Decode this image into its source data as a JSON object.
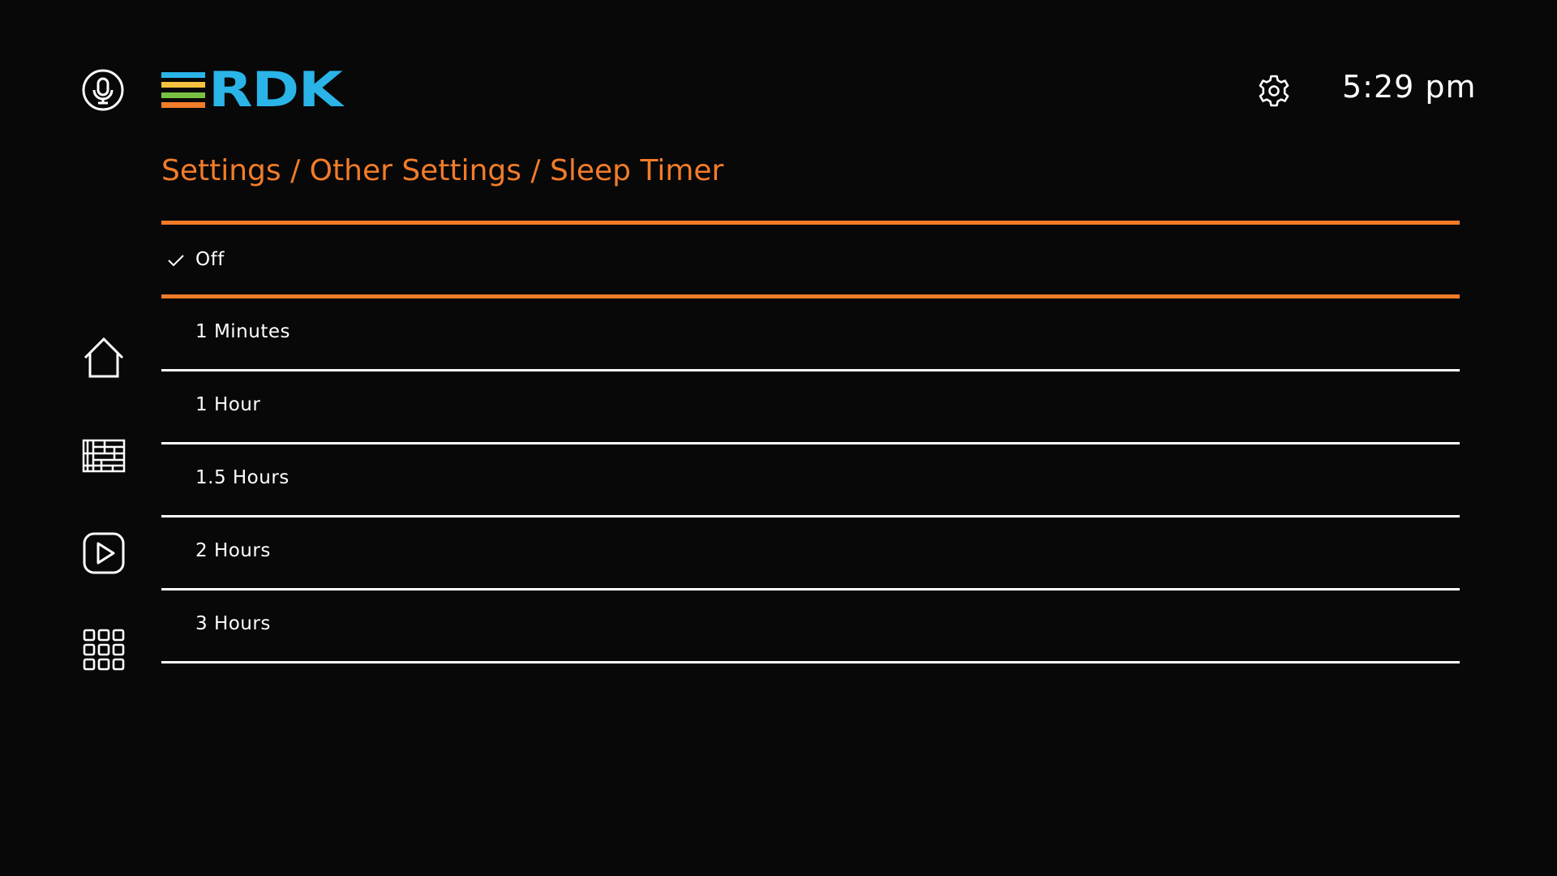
{
  "header": {
    "logo_text": "RDK",
    "logo_colors": [
      "#2ab4e8",
      "#f6c23e",
      "#7ac143",
      "#f27c2a"
    ],
    "time": "5:29 pm",
    "icons": {
      "mic": "microphone-icon",
      "settings": "gear-icon"
    }
  },
  "sidebar": {
    "items": [
      {
        "name": "home",
        "icon": "home-icon"
      },
      {
        "name": "guide",
        "icon": "epg-grid-icon"
      },
      {
        "name": "play",
        "icon": "play-icon"
      },
      {
        "name": "apps",
        "icon": "apps-grid-icon"
      }
    ]
  },
  "breadcrumb": "Settings / Other Settings / Sleep Timer",
  "options": [
    {
      "label": "Off",
      "checked": true
    },
    {
      "label": "1 Minutes",
      "checked": false
    },
    {
      "label": "1 Hour",
      "checked": false
    },
    {
      "label": "1.5 Hours",
      "checked": false
    },
    {
      "label": "2 Hours",
      "checked": false
    },
    {
      "label": "3 Hours",
      "checked": false
    }
  ],
  "colors": {
    "accent": "#f27c2a",
    "background": "#080808",
    "text": "#ffffff"
  }
}
